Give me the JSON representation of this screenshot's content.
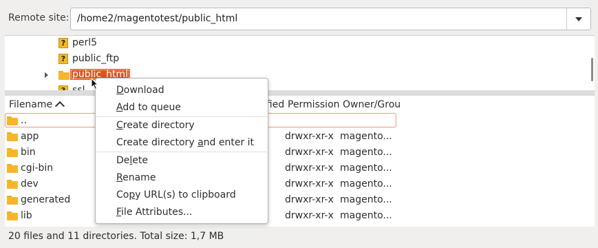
{
  "remote": {
    "label": "Remote site:",
    "path": "/home2/magentotest/public_html"
  },
  "tree": {
    "items": [
      {
        "name": "perl5",
        "icon": "question-folder"
      },
      {
        "name": "public_ftp",
        "icon": "question-folder"
      },
      {
        "name": "public_html",
        "icon": "folder",
        "selected": true,
        "expandable": true
      },
      {
        "name": "ssl",
        "icon": "question-folder"
      }
    ]
  },
  "files": {
    "headers": {
      "filename": "Filename",
      "modified": "ified",
      "permission": "Permission",
      "owner": "Owner/Grou"
    },
    "rows": [
      {
        "name": "..",
        "perm": "",
        "owner": ""
      },
      {
        "name": "app",
        "perm": "drwxr-xr-x",
        "owner": "magento..."
      },
      {
        "name": "bin",
        "perm": "drwxr-xr-x",
        "owner": "magento..."
      },
      {
        "name": "cgi-bin",
        "perm": "drwxr-xr-x",
        "owner": "magento..."
      },
      {
        "name": "dev",
        "perm": "drwxr-xr-x",
        "owner": "magento..."
      },
      {
        "name": "generated",
        "perm": "drwxr-xr-x",
        "owner": "magento..."
      },
      {
        "name": "lib",
        "perm": "drwxr-xr-x",
        "owner": "magento..."
      }
    ]
  },
  "status": "20 files and 11 directories. Total size: 1,7 MB",
  "context_menu": {
    "download": {
      "pre": "",
      "ul": "D",
      "post": "ownload"
    },
    "add_to_queue": {
      "pre": "",
      "ul": "A",
      "post": "dd to queue"
    },
    "create_directory": {
      "pre": "",
      "ul": "C",
      "post": "reate directory"
    },
    "create_directory_enter": {
      "pre": "Create directory ",
      "ul": "a",
      "post": "nd enter it"
    },
    "delete": {
      "pre": "De",
      "ul": "l",
      "post": "ete"
    },
    "rename": {
      "pre": "",
      "ul": "R",
      "post": "ename"
    },
    "copy_url": {
      "pre": "Co",
      "ul": "p",
      "post": "y URL(s) to clipboard"
    },
    "file_attributes": {
      "pre": "",
      "ul": "F",
      "post": "ile Attributes..."
    }
  },
  "colors": {
    "selection": "#e0531e",
    "folder": "#f7b52c",
    "unknown_folder": "#f0b928"
  }
}
